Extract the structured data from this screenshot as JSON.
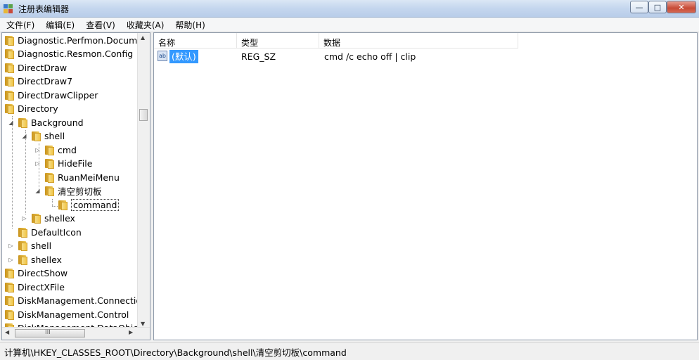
{
  "window": {
    "title": "注册表编辑器",
    "controls": {
      "minimize": "—",
      "maximize": "□",
      "close": "✕"
    }
  },
  "menu": {
    "file": "文件(F)",
    "edit": "编辑(E)",
    "view": "查看(V)",
    "favorites": "收藏夹(A)",
    "help": "帮助(H)"
  },
  "tree": {
    "n0": "Diagnostic.Perfmon.Document",
    "n1": "Diagnostic.Resmon.Config",
    "n2": "DirectDraw",
    "n3": "DirectDraw7",
    "n4": "DirectDrawClipper",
    "n5": "Directory",
    "n6": "Background",
    "n7": "shell",
    "n8": "cmd",
    "n9": "HideFile",
    "n10": "RuanMeiMenu",
    "n11": "清空剪切板",
    "n12": "command",
    "n13": "shellex",
    "n14": "DefaultIcon",
    "n15": "shell",
    "n16": "shellex",
    "n17": "DirectShow",
    "n18": "DirectXFile",
    "n19": "DiskManagement.Connection",
    "n20": "DiskManagement.Control",
    "n21": "DiskManagement.DataObject",
    "hscroll_grip": "III"
  },
  "list": {
    "headers": {
      "name": "名称",
      "type": "类型",
      "data": "数据"
    },
    "row": {
      "icon_text": "ab",
      "name": "(默认)",
      "type": "REG_SZ",
      "data": "cmd /c echo off | clip"
    }
  },
  "status": {
    "path": "计算机\\HKEY_CLASSES_ROOT\\Directory\\Background\\shell\\清空剪切板\\command"
  }
}
